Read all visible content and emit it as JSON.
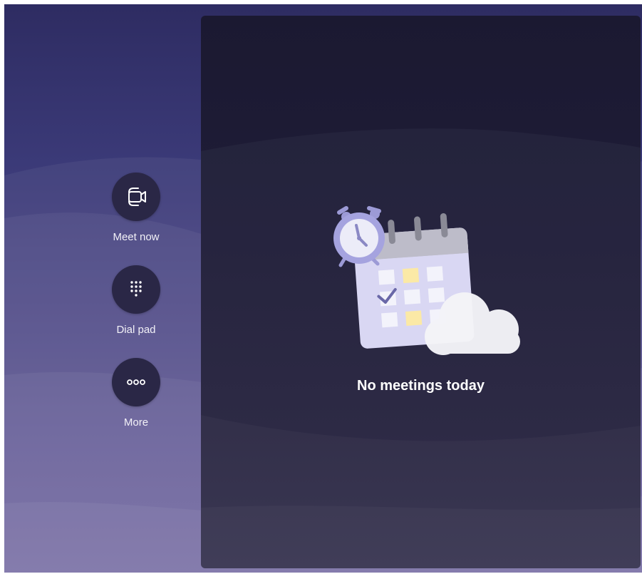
{
  "actions": [
    {
      "label": "Meet now",
      "icon": "video-camera-icon"
    },
    {
      "label": "Dial pad",
      "icon": "dial-pad-icon"
    },
    {
      "label": "More",
      "icon": "more-icon"
    }
  ],
  "main": {
    "empty_state_text": "No meetings today",
    "illustration": "calendar-clock-cloud-illustration"
  },
  "colors": {
    "background_top": "#2e2c62",
    "background_bottom": "#6b5f9c",
    "panel": "#1f1d38",
    "button_circle": "#2a2746",
    "text": "#ffffff"
  }
}
